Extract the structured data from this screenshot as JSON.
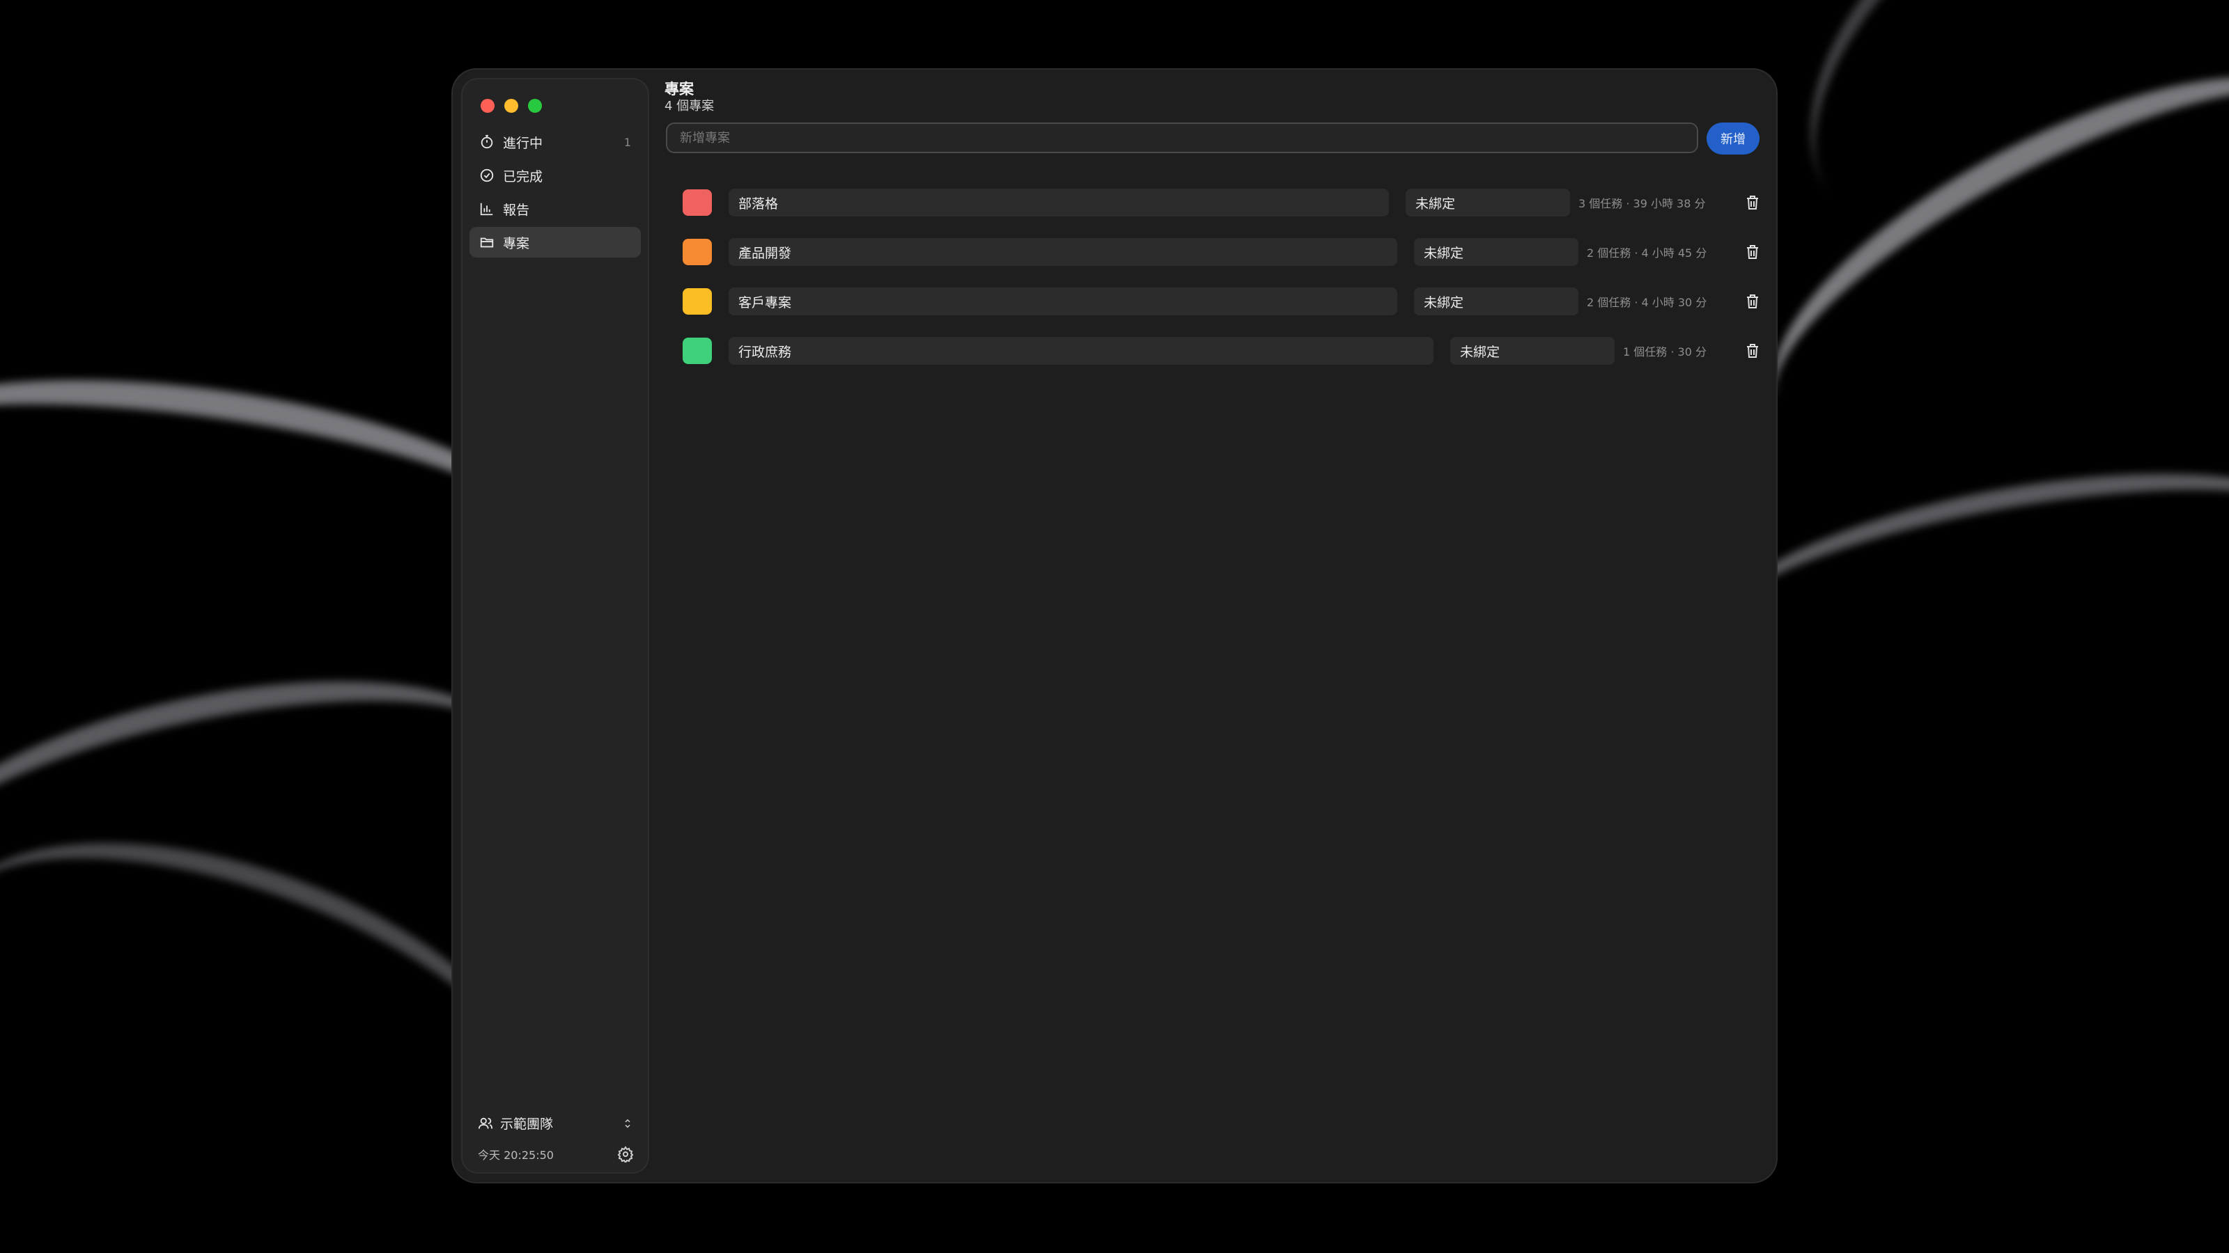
{
  "sidebar": {
    "items": [
      {
        "label": "進行中",
        "count": "1",
        "icon": "timer-icon"
      },
      {
        "label": "已完成",
        "count": "",
        "icon": "check-circle-icon"
      },
      {
        "label": "報告",
        "count": "",
        "icon": "bar-chart-icon"
      },
      {
        "label": "專案",
        "count": "",
        "icon": "folder-icon"
      }
    ],
    "active_index": 3,
    "team_name": "示範團隊",
    "time": "今天 20:25:50"
  },
  "header": {
    "title": "專案",
    "subtitle": "4 個專案"
  },
  "new_project": {
    "placeholder": "新增專案",
    "value": "",
    "add_label": "新增"
  },
  "projects": [
    {
      "name": "部落格",
      "color": "#f0625f",
      "binding": "未綁定",
      "meta": "3 個任務 · 39 小時 38 分"
    },
    {
      "name": "產品開發",
      "color": "#f58a32",
      "binding": "未綁定",
      "meta": "2 個任務 · 4 小時 45 分"
    },
    {
      "name": "客戶專案",
      "color": "#fbbd24",
      "binding": "未綁定",
      "meta": "2 個任務 · 4 小時 30 分"
    },
    {
      "name": "行政庶務",
      "color": "#3ed07a",
      "binding": "未綁定",
      "meta": "1 個任務 · 30 分"
    }
  ],
  "colors": {
    "accent": "#2460c9",
    "window_bg": "#1e1e1e",
    "sidebar_bg": "#242424"
  }
}
